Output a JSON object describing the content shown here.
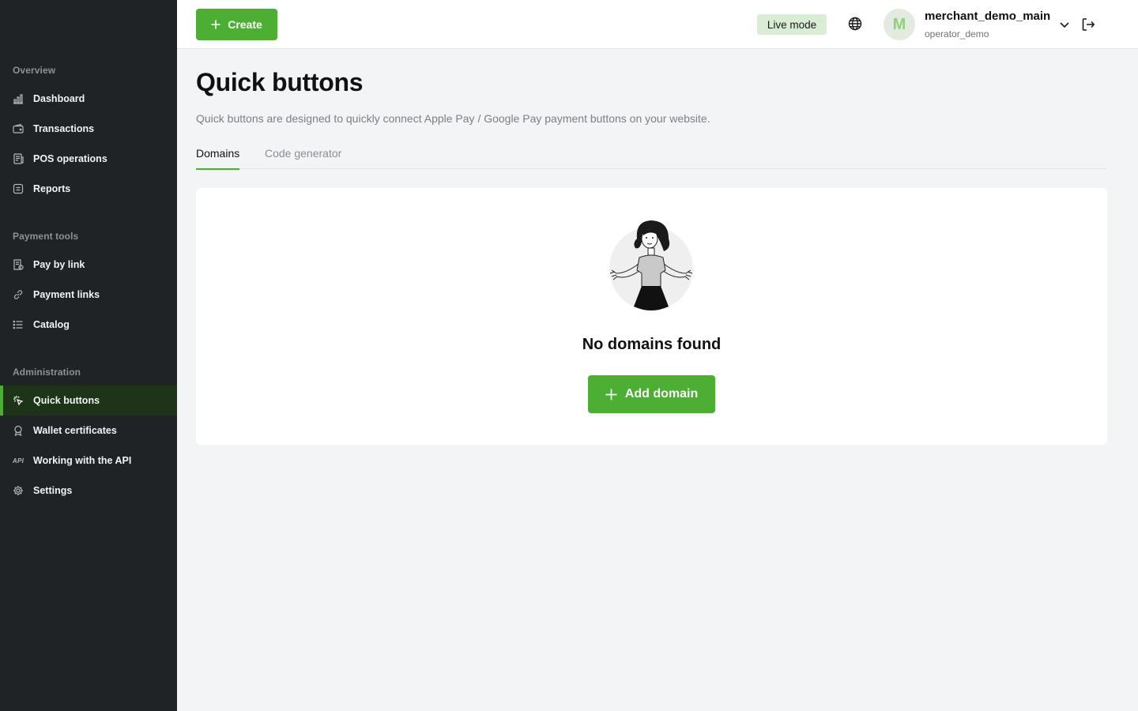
{
  "sidebar": {
    "sections": [
      {
        "title": "Overview",
        "items": [
          {
            "label": "Dashboard",
            "icon": "bar-chart-icon"
          },
          {
            "label": "Transactions",
            "icon": "wallet-icon"
          },
          {
            "label": "POS operations",
            "icon": "receipt-icon"
          },
          {
            "label": "Reports",
            "icon": "report-icon"
          }
        ]
      },
      {
        "title": "Payment tools",
        "items": [
          {
            "label": "Pay by link",
            "icon": "invoice-icon"
          },
          {
            "label": "Payment links",
            "icon": "link-icon"
          },
          {
            "label": "Catalog",
            "icon": "list-icon"
          }
        ]
      },
      {
        "title": "Administration",
        "items": [
          {
            "label": "Quick buttons",
            "icon": "click-icon",
            "active": true
          },
          {
            "label": "Wallet certificates",
            "icon": "certificate-icon"
          },
          {
            "label": "Working with the API",
            "icon": "api-icon",
            "icon_text": "API"
          },
          {
            "label": "Settings",
            "icon": "gear-icon"
          }
        ]
      }
    ]
  },
  "header": {
    "create_label": "Create",
    "mode_label": "Live mode",
    "avatar_letter": "M",
    "account_name": "merchant_demo_main",
    "account_user": "operator_demo"
  },
  "main": {
    "title": "Quick buttons",
    "description": "Quick buttons are designed to quickly connect Apple Pay / Google Pay payment buttons on your website.",
    "tabs": [
      {
        "label": "Domains",
        "active": true
      },
      {
        "label": "Code generator",
        "active": false
      }
    ],
    "empty_state": {
      "title": "No domains found",
      "button_label": "Add domain"
    }
  },
  "colors": {
    "accent": "#4caf34",
    "sidebar_bg": "#1f2326",
    "active_bg": "#1e3418",
    "live_badge_bg": "#d9ecd4"
  }
}
